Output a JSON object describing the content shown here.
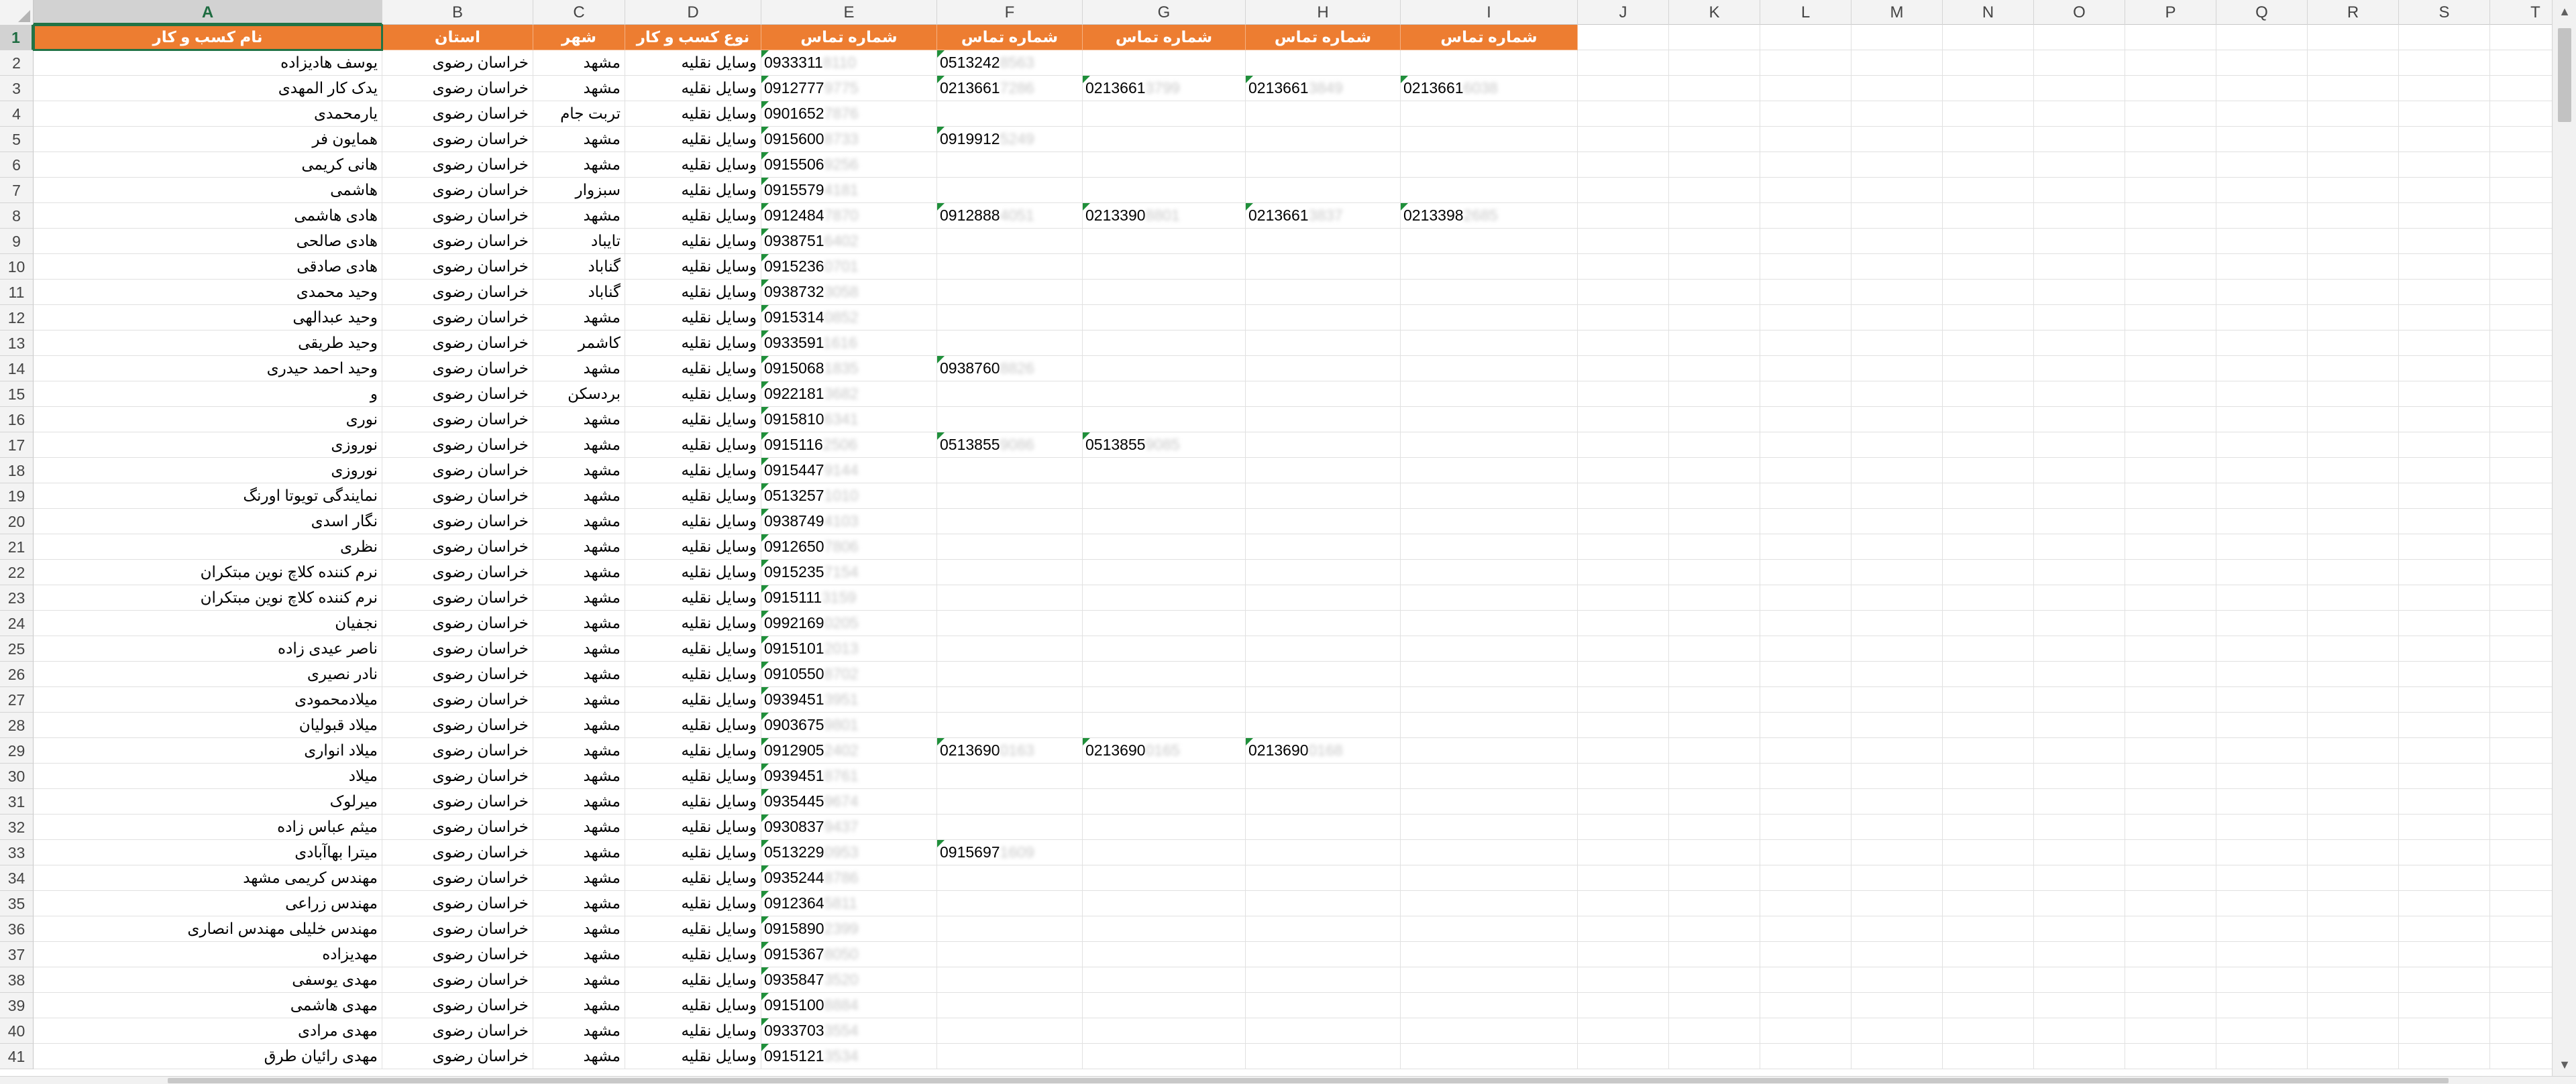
{
  "app": {
    "title": "Excel"
  },
  "colors": {
    "header_fill": "#ed7d31",
    "header_text": "#ffffff",
    "selection": "#217346",
    "error_flag": "#1f8f3a"
  },
  "columns": [
    "A",
    "B",
    "C",
    "D",
    "E",
    "F",
    "G",
    "H",
    "I",
    "J",
    "K",
    "L",
    "M",
    "N",
    "O",
    "P",
    "Q",
    "R",
    "S",
    "T"
  ],
  "active_cell": "A1",
  "header_row": {
    "A": "نام کسب و کار",
    "B": "استان",
    "C": "شهر",
    "D": "نوع کسب و کار",
    "E": "شماره تماس",
    "F": "شماره تماس",
    "G": "شماره تماس",
    "H": "شماره تماس",
    "I": "شماره تماس"
  },
  "rows": [
    {
      "n": "2",
      "name": "یوسف هادیزاده",
      "province": "خراسان رضوی",
      "city": "مشهد",
      "type": "وسایل نقلیه",
      "e": "0933311",
      "eh": "8110",
      "f": "0513242",
      "fh": "8563"
    },
    {
      "n": "3",
      "name": "یدک کار المهدی",
      "province": "خراسان رضوی",
      "city": "مشهد",
      "type": "وسایل نقلیه",
      "e": "0912777",
      "eh": "9775",
      "f": "0213661",
      "fh": "7286",
      "g": "0213661",
      "gh": "3799",
      "h": "0213661",
      "hh": "3849",
      "i": "0213661",
      "ih": "6038"
    },
    {
      "n": "4",
      "name": "یارمحمدی",
      "province": "خراسان رضوی",
      "city": "تربت جام",
      "type": "وسایل نقلیه",
      "e": "0901652",
      "eh": "7876"
    },
    {
      "n": "5",
      "name": "همایون فر",
      "province": "خراسان رضوی",
      "city": "مشهد",
      "type": "وسایل نقلیه",
      "e": "0915600",
      "eh": "8733",
      "f": "0919912",
      "fh": "5249"
    },
    {
      "n": "6",
      "name": "هانی کریمی",
      "province": "خراسان رضوی",
      "city": "مشهد",
      "type": "وسایل نقلیه",
      "e": "0915506",
      "eh": "9256"
    },
    {
      "n": "7",
      "name": "هاشمی",
      "province": "خراسان رضوی",
      "city": "سبزوار",
      "type": "وسایل نقلیه",
      "e": "0915579",
      "eh": "4181"
    },
    {
      "n": "8",
      "name": "هادی هاشمی",
      "province": "خراسان رضوی",
      "city": "مشهد",
      "type": "وسایل نقلیه",
      "e": "0912484",
      "eh": "7870",
      "f": "0912888",
      "fh": "4051",
      "g": "0213390",
      "gh": "8801",
      "h": "0213661",
      "hh": "3837",
      "i": "0213398",
      "ih": "2685"
    },
    {
      "n": "9",
      "name": "هادی صالحی",
      "province": "خراسان رضوی",
      "city": "تایباد",
      "type": "وسایل نقلیه",
      "e": "0938751",
      "eh": "6402"
    },
    {
      "n": "10",
      "name": "هادی صادقی",
      "province": "خراسان رضوی",
      "city": "گناباد",
      "type": "وسایل نقلیه",
      "e": "0915236",
      "eh": "0701"
    },
    {
      "n": "11",
      "name": "وحید محمدی",
      "province": "خراسان رضوی",
      "city": "گناباد",
      "type": "وسایل نقلیه",
      "e": "0938732",
      "eh": "3058"
    },
    {
      "n": "12",
      "name": "وحید عبدالهی",
      "province": "خراسان رضوی",
      "city": "مشهد",
      "type": "وسایل نقلیه",
      "e": "0915314",
      "eh": "0852"
    },
    {
      "n": "13",
      "name": "وحید طریقی",
      "province": "خراسان رضوی",
      "city": "کاشمر",
      "type": "وسایل نقلیه",
      "e": "0933591",
      "eh": "1616"
    },
    {
      "n": "14",
      "name": "وحید احمد حیدری",
      "province": "خراسان رضوی",
      "city": "مشهد",
      "type": "وسایل نقلیه",
      "e": "0915068",
      "eh": "1835",
      "f": "0938760",
      "fh": "8826"
    },
    {
      "n": "15",
      "name": "و",
      "province": "خراسان رضوی",
      "city": "بردسکن",
      "type": "وسایل نقلیه",
      "e": "0922181",
      "eh": "3682"
    },
    {
      "n": "16",
      "name": "نوری",
      "province": "خراسان رضوی",
      "city": "مشهد",
      "type": "وسایل نقلیه",
      "e": "0915810",
      "eh": "6341"
    },
    {
      "n": "17",
      "name": "نوروزی",
      "province": "خراسان رضوی",
      "city": "مشهد",
      "type": "وسایل نقلیه",
      "e": "0915116",
      "eh": "2506",
      "f": "0513855",
      "fh": "9086",
      "g": "0513855",
      "gh": "9085"
    },
    {
      "n": "18",
      "name": "نوروزی",
      "province": "خراسان رضوی",
      "city": "مشهد",
      "type": "وسایل نقلیه",
      "e": "0915447",
      "eh": "9144"
    },
    {
      "n": "19",
      "name": "نمایندگی تویوتا اورنگ",
      "province": "خراسان رضوی",
      "city": "مشهد",
      "type": "وسایل نقلیه",
      "e": "0513257",
      "eh": "1010"
    },
    {
      "n": "20",
      "name": "نگار اسدی",
      "province": "خراسان رضوی",
      "city": "مشهد",
      "type": "وسایل نقلیه",
      "e": "0938749",
      "eh": "4103"
    },
    {
      "n": "21",
      "name": "نظری",
      "province": "خراسان رضوی",
      "city": "مشهد",
      "type": "وسایل نقلیه",
      "e": "0912650",
      "eh": "7806"
    },
    {
      "n": "22",
      "name": "نرم کننده کلاچ نوین مبتکران",
      "province": "خراسان رضوی",
      "city": "مشهد",
      "type": "وسایل نقلیه",
      "e": "0915235",
      "eh": "7154"
    },
    {
      "n": "23",
      "name": "نرم کننده کلاچ نوین مبتکران",
      "province": "خراسان رضوی",
      "city": "مشهد",
      "type": "وسایل نقلیه",
      "e": "0915111",
      "eh": "3159"
    },
    {
      "n": "24",
      "name": "نجفیان",
      "province": "خراسان رضوی",
      "city": "مشهد",
      "type": "وسایل نقلیه",
      "e": "0992169",
      "eh": "0205"
    },
    {
      "n": "25",
      "name": "ناصر عیدی زاده",
      "province": "خراسان رضوی",
      "city": "مشهد",
      "type": "وسایل نقلیه",
      "e": "0915101",
      "eh": "2013"
    },
    {
      "n": "26",
      "name": "نادر  نصیری",
      "province": "خراسان رضوی",
      "city": "مشهد",
      "type": "وسایل نقلیه",
      "e": "0910550",
      "eh": "8702"
    },
    {
      "n": "27",
      "name": "میلادمحمودی",
      "province": "خراسان رضوی",
      "city": "مشهد",
      "type": "وسایل نقلیه",
      "e": "0939451",
      "eh": "3951"
    },
    {
      "n": "28",
      "name": "میلاد قبولیان",
      "province": "خراسان رضوی",
      "city": "مشهد",
      "type": "وسایل نقلیه",
      "e": "0903675",
      "eh": "9801"
    },
    {
      "n": "29",
      "name": "میلاد انواری",
      "province": "خراسان رضوی",
      "city": "مشهد",
      "type": "وسایل نقلیه",
      "e": "0912905",
      "eh": "2402",
      "f": "0213690",
      "fh": "0163",
      "g": "0213690",
      "gh": "0165",
      "h": "0213690",
      "hh": "0168"
    },
    {
      "n": "30",
      "name": "میلاد",
      "province": "خراسان رضوی",
      "city": "مشهد",
      "type": "وسایل نقلیه",
      "e": "0939451",
      "eh": "8761"
    },
    {
      "n": "31",
      "name": "میرلوک",
      "province": "خراسان رضوی",
      "city": "مشهد",
      "type": "وسایل نقلیه",
      "e": "0935445",
      "eh": "9674"
    },
    {
      "n": "32",
      "name": "میثم عباس زاده",
      "province": "خراسان رضوی",
      "city": "مشهد",
      "type": "وسایل نقلیه",
      "e": "0930837",
      "eh": "9437"
    },
    {
      "n": "33",
      "name": "میترا بهاآبادی",
      "province": "خراسان رضوی",
      "city": "مشهد",
      "type": "وسایل نقلیه",
      "e": "0513229",
      "eh": "0953",
      "f": "0915697",
      "fh": "1609"
    },
    {
      "n": "34",
      "name": "مهندس کریمی      مشهد",
      "province": "خراسان رضوی",
      "city": "مشهد",
      "type": "وسایل نقلیه",
      "e": "0935244",
      "eh": "8786"
    },
    {
      "n": "35",
      "name": "مهندس زراعی",
      "province": "خراسان رضوی",
      "city": "مشهد",
      "type": "وسایل نقلیه",
      "e": "0912364",
      "eh": "5811"
    },
    {
      "n": "36",
      "name": "مهندس خلیلی مهندس انصاری",
      "province": "خراسان رضوی",
      "city": "مشهد",
      "type": "وسایل نقلیه",
      "e": "0915890",
      "eh": "2399"
    },
    {
      "n": "37",
      "name": "مهدیزاده",
      "province": "خراسان رضوی",
      "city": "مشهد",
      "type": "وسایل نقلیه",
      "e": "0915367",
      "eh": "8050"
    },
    {
      "n": "38",
      "name": "مهدی یوسفی",
      "province": "خراسان رضوی",
      "city": "مشهد",
      "type": "وسایل نقلیه",
      "e": "0935847",
      "eh": "3520"
    },
    {
      "n": "39",
      "name": "مهدی هاشمی",
      "province": "خراسان رضوی",
      "city": "مشهد",
      "type": "وسایل نقلیه",
      "e": "0915100",
      "eh": "8884"
    },
    {
      "n": "40",
      "name": "مهدی مرادی",
      "province": "خراسان رضوی",
      "city": "مشهد",
      "type": "وسایل نقلیه",
      "e": "0933703",
      "eh": "3554"
    },
    {
      "n": "41",
      "name": "مهدی رائیان طرق",
      "province": "خراسان رضوی",
      "city": "مشهد",
      "type": "وسایل نقلیه",
      "e": "0915121",
      "eh": "3534"
    }
  ],
  "scrollbar": {
    "up_arrow": "▲",
    "down_arrow": "▼"
  }
}
